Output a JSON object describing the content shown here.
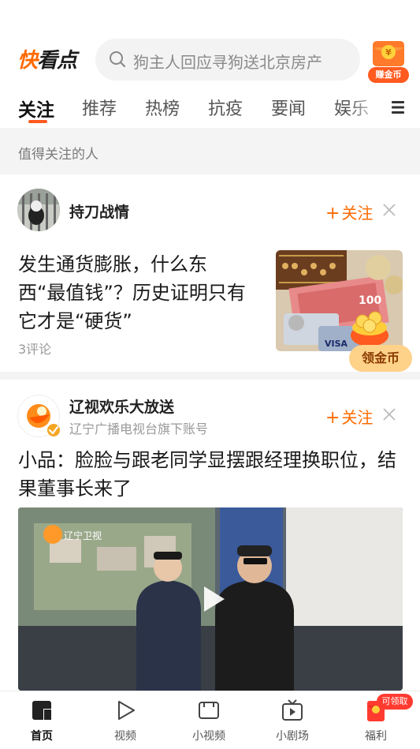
{
  "header": {
    "logo": "快看点",
    "search_placeholder": "狗主人回应寻狗送北京房产",
    "coin_label": "赚金币"
  },
  "tabs": [
    {
      "label": "关注",
      "active": true
    },
    {
      "label": "推荐"
    },
    {
      "label": "热榜"
    },
    {
      "label": "抗疫"
    },
    {
      "label": "要闻"
    },
    {
      "label": "娱乐"
    }
  ],
  "section": {
    "title": "值得关注的人"
  },
  "card1": {
    "author": "持刀战情",
    "follow_label": "关注",
    "headline": "发生通货膨胀，什么东西“最值钱”？历史证明只有它才是“硬货”",
    "comments": "3评论",
    "gold_button": "领金币"
  },
  "card2": {
    "author": "辽视欢乐大放送",
    "subtitle": "辽宁广播电视台旗下账号",
    "follow_label": "关注",
    "headline": "小品：脸脸与跟老同学显摆跟经理换职位，结果董事长来了"
  },
  "bottom_nav": [
    {
      "label": "首页",
      "icon": "home-icon",
      "active": true
    },
    {
      "label": "视频",
      "icon": "video-play-icon"
    },
    {
      "label": "小视频",
      "icon": "short-video-icon"
    },
    {
      "label": "小剧场",
      "icon": "theater-icon"
    },
    {
      "label": "福利",
      "icon": "red-envelope-icon"
    }
  ],
  "reward_badge": "可领取",
  "colors": {
    "accent": "#ff6a00",
    "badge": "#ff3b30"
  }
}
